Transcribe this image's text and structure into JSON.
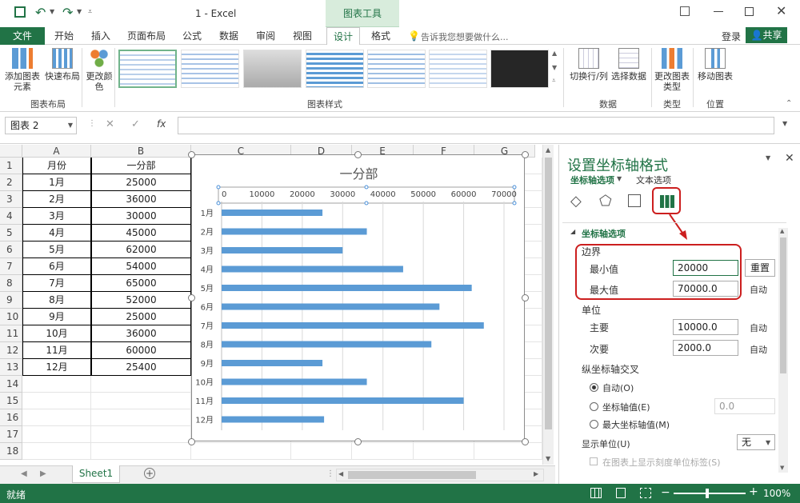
{
  "window": {
    "title": "1 - Excel",
    "context_tab": "图表工具"
  },
  "tabs": [
    "文件",
    "开始",
    "插入",
    "页面布局",
    "公式",
    "数据",
    "审阅",
    "视图",
    "设计",
    "格式"
  ],
  "active_tab": "设计",
  "search_hint": "告诉我您想要做什么...",
  "account": {
    "login": "登录",
    "share": "共享"
  },
  "ribbon": {
    "add_element": "添加图表元素",
    "quick_layout": "快速布局",
    "change_colors": "更改颜色",
    "group_layout": "图表布局",
    "group_styles": "图表样式",
    "switch_rowcol": "切换行/列",
    "select_data": "选择数据",
    "group_data": "数据",
    "change_type": "更改图表类型",
    "group_type": "类型",
    "move_chart": "移动图表",
    "group_location": "位置"
  },
  "namebox": "图表 2",
  "fx": "fx",
  "columns": [
    "A",
    "B",
    "C",
    "D",
    "E",
    "F",
    "G"
  ],
  "rows": [
    "1",
    "2",
    "3",
    "4",
    "5",
    "6",
    "7",
    "8",
    "9",
    "10",
    "11",
    "12",
    "13",
    "14",
    "15",
    "16",
    "17",
    "18"
  ],
  "table": {
    "header": [
      "月份",
      "一分部"
    ],
    "rows": [
      [
        "1月",
        "25000"
      ],
      [
        "2月",
        "36000"
      ],
      [
        "3月",
        "30000"
      ],
      [
        "4月",
        "45000"
      ],
      [
        "5月",
        "62000"
      ],
      [
        "6月",
        "54000"
      ],
      [
        "7月",
        "65000"
      ],
      [
        "8月",
        "52000"
      ],
      [
        "9月",
        "25000"
      ],
      [
        "10月",
        "36000"
      ],
      [
        "11月",
        "60000"
      ],
      [
        "12月",
        "25400"
      ]
    ]
  },
  "chart_data": {
    "type": "bar",
    "title": "一分部",
    "categories": [
      "1月",
      "2月",
      "3月",
      "4月",
      "5月",
      "6月",
      "7月",
      "8月",
      "9月",
      "10月",
      "11月",
      "12月"
    ],
    "values": [
      25000,
      36000,
      30000,
      45000,
      62000,
      54000,
      65000,
      52000,
      25000,
      36000,
      60000,
      25400
    ],
    "xlim": [
      0,
      70000
    ],
    "xticks": [
      "0",
      "10000",
      "20000",
      "30000",
      "40000",
      "50000",
      "60000",
      "70000"
    ],
    "bar_color": "#5b9bd5",
    "grid": true
  },
  "panel": {
    "title": "设置坐标轴格式",
    "tab_axis": "坐标轴选项",
    "tab_text": "文本选项",
    "section": "坐标轴选项",
    "bounds": "边界",
    "min_label": "最小值",
    "min_value": "20000",
    "reset": "重置",
    "max_label": "最大值",
    "max_value": "70000.0",
    "auto": "自动",
    "units": "单位",
    "major_label": "主要",
    "major_value": "10000.0",
    "minor_label": "次要",
    "minor_value": "2000.0",
    "cross": "纵坐标轴交叉",
    "opt_auto": "自动(O)",
    "opt_value": "坐标轴值(E)",
    "opt_value_val": "0.0",
    "opt_max": "最大坐标轴值(M)",
    "display_units": "显示单位(U)",
    "display_units_val": "无",
    "show_label": "在图表上显示刻度单位标签(S)"
  },
  "sheet": "Sheet1",
  "status": {
    "ready": "就绪",
    "zoom": "100%"
  },
  "colors": {
    "brand": "#217346",
    "highlight": "#cc1f1f"
  }
}
